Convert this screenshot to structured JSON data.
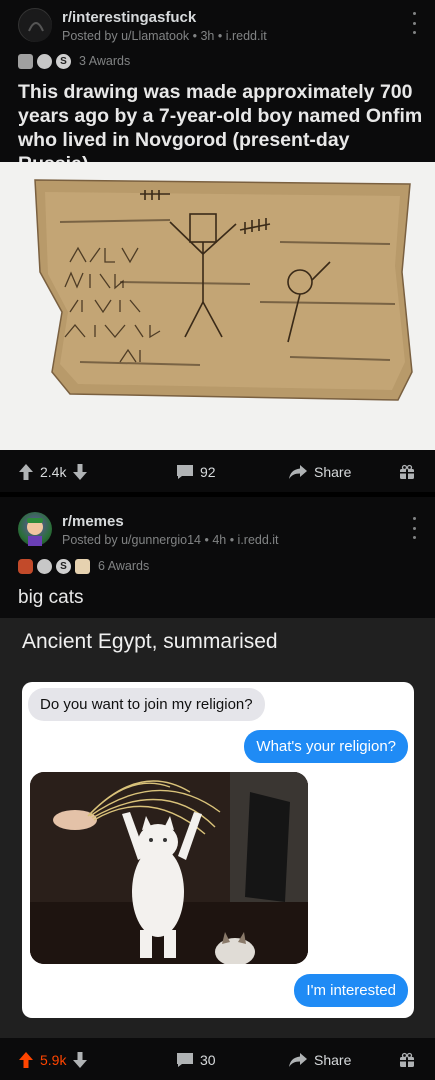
{
  "posts": [
    {
      "subreddit": "r/interestingasfuck",
      "posted_by": "Posted by u/Llamatook • 3h • i.redd.it",
      "awards_label": "3 Awards",
      "title": "This drawing was made approximately 700 years ago by a 7-year-old boy named Onfim who lived in Novgorod (present-day Russia).",
      "upvotes": "2.4k",
      "comments": "92",
      "share_label": "Share"
    },
    {
      "subreddit": "r/memes",
      "posted_by": "Posted by u/gunnergio14 • 4h • i.redd.it",
      "awards_label": "6 Awards",
      "title": "big cats",
      "meme_caption": "Ancient Egypt, summarised",
      "chat": {
        "msg1": "Do you want to join my religion?",
        "msg2": "What's your religion?",
        "msg3": "I'm interested"
      },
      "upvotes": "5.9k",
      "comments": "30",
      "share_label": "Share"
    }
  ],
  "colors": {
    "upvote_active": "#ff4500",
    "imessage_blue": "#1f8bf5",
    "background": "#0b0b0c"
  },
  "icons": [
    "upvote-arrow-icon",
    "downvote-arrow-icon",
    "comment-bubble-icon",
    "share-arrow-icon",
    "gift-icon",
    "kebab-menu-icon"
  ]
}
